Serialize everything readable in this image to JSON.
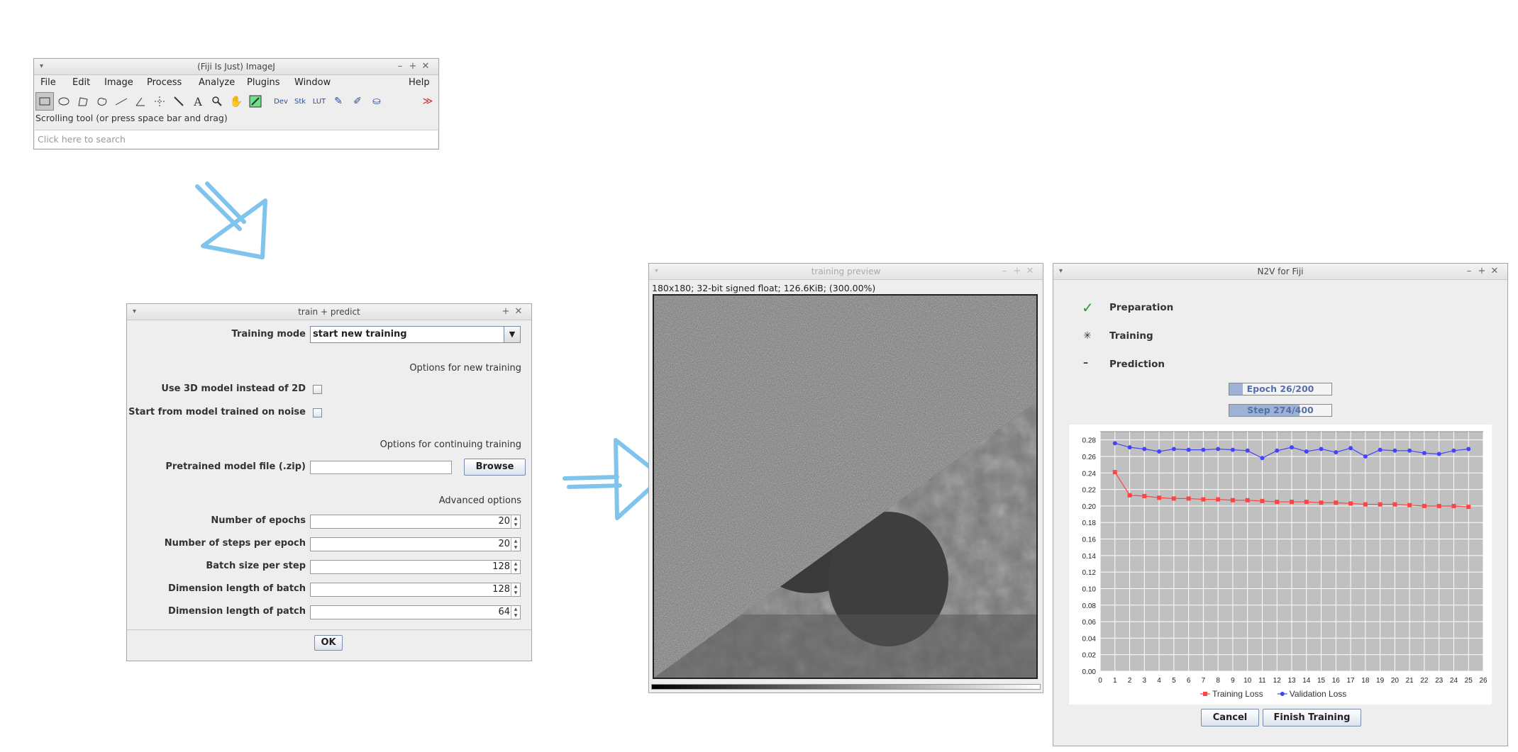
{
  "imagej": {
    "title": "(Fiji Is Just) ImageJ",
    "menus": [
      "File",
      "Edit",
      "Image",
      "Process",
      "Analyze",
      "Plugins",
      "Window",
      "Help"
    ],
    "tools": [
      "rectangle-tool",
      "oval-tool",
      "polygon-tool",
      "freehand-tool",
      "line-tool",
      "angle-tool",
      "point-tool",
      "wand-tool",
      "text-tool",
      "magnifier-tool",
      "hand-tool",
      "color-picker-tool",
      "dev-tool",
      "stk-tool",
      "lut-tool",
      "pencil-tool",
      "brush-tool",
      "flood-fill-tool"
    ],
    "tool_labels": {
      "dev": "Dev",
      "stk": "Stk",
      "lut": "LUT"
    },
    "status": "Scrolling tool (or press space bar and drag)",
    "search_placeholder": "Click here to search"
  },
  "dialog": {
    "title": "train + predict",
    "training_mode_label": "Training mode",
    "training_mode_value": "start new training",
    "section_new": "Options for new training",
    "use3d_label": "Use 3D model instead of 2D",
    "noise_label": "Start from model trained on noise",
    "section_continue": "Options for continuing training",
    "pretrained_label": "Pretrained model file (.zip)",
    "pretrained_value": "",
    "browse_label": "Browse",
    "section_advanced": "Advanced options",
    "fields": [
      {
        "label": "Number of epochs",
        "value": "20"
      },
      {
        "label": "Number of steps per epoch",
        "value": "20"
      },
      {
        "label": "Batch size per step",
        "value": "128"
      },
      {
        "label": "Dimension length of batch",
        "value": "128"
      },
      {
        "label": "Dimension length of patch",
        "value": "64"
      }
    ],
    "ok_label": "OK"
  },
  "preview": {
    "title": "training preview",
    "info": "180x180; 32-bit signed float; 126.6KiB; (300.00%)"
  },
  "n2v": {
    "title": "N2V for Fiji",
    "steps": [
      {
        "label": "Preparation",
        "state": "done"
      },
      {
        "label": "Training",
        "state": "running"
      },
      {
        "label": "Prediction",
        "state": "pending"
      }
    ],
    "epoch_text": "Epoch 26/200",
    "epoch_progress": 0.13,
    "step_text": "Step 274/400",
    "step_progress": 0.685,
    "cancel_label": "Cancel",
    "finish_label": "Finish Training"
  },
  "chart_data": {
    "type": "line",
    "x": [
      1,
      2,
      3,
      4,
      5,
      6,
      7,
      8,
      9,
      10,
      11,
      12,
      13,
      14,
      15,
      16,
      17,
      18,
      19,
      20,
      21,
      22,
      23,
      24,
      25
    ],
    "series": [
      {
        "name": "Training Loss",
        "color": "#ff4444",
        "marker": "square",
        "values": [
          0.241,
          0.213,
          0.212,
          0.21,
          0.209,
          0.209,
          0.208,
          0.208,
          0.207,
          0.207,
          0.206,
          0.205,
          0.205,
          0.205,
          0.204,
          0.204,
          0.203,
          0.202,
          0.202,
          0.202,
          0.201,
          0.2,
          0.2,
          0.2,
          0.199
        ]
      },
      {
        "name": "Validation Loss",
        "color": "#4444ff",
        "marker": "circle",
        "values": [
          0.276,
          0.271,
          0.269,
          0.266,
          0.269,
          0.268,
          0.268,
          0.269,
          0.268,
          0.267,
          0.258,
          0.267,
          0.271,
          0.266,
          0.269,
          0.265,
          0.27,
          0.26,
          0.268,
          0.267,
          0.267,
          0.264,
          0.263,
          0.267,
          0.269
        ]
      }
    ],
    "xlim": [
      0,
      26
    ],
    "ylim": [
      0,
      0.29
    ],
    "xticks": [
      "0",
      "1",
      "2",
      "3",
      "4",
      "5",
      "6",
      "7",
      "8",
      "9",
      "10",
      "11",
      "12",
      "13",
      "14",
      "15",
      "16",
      "17",
      "18",
      "19",
      "20",
      "21",
      "22",
      "23",
      "24",
      "25",
      "26"
    ],
    "yticks": [
      "0.00",
      "0.02",
      "0.04",
      "0.06",
      "0.08",
      "0.10",
      "0.12",
      "0.14",
      "0.16",
      "0.18",
      "0.20",
      "0.22",
      "0.24",
      "0.26",
      "0.28"
    ],
    "grid": true,
    "legend": "bottom"
  }
}
